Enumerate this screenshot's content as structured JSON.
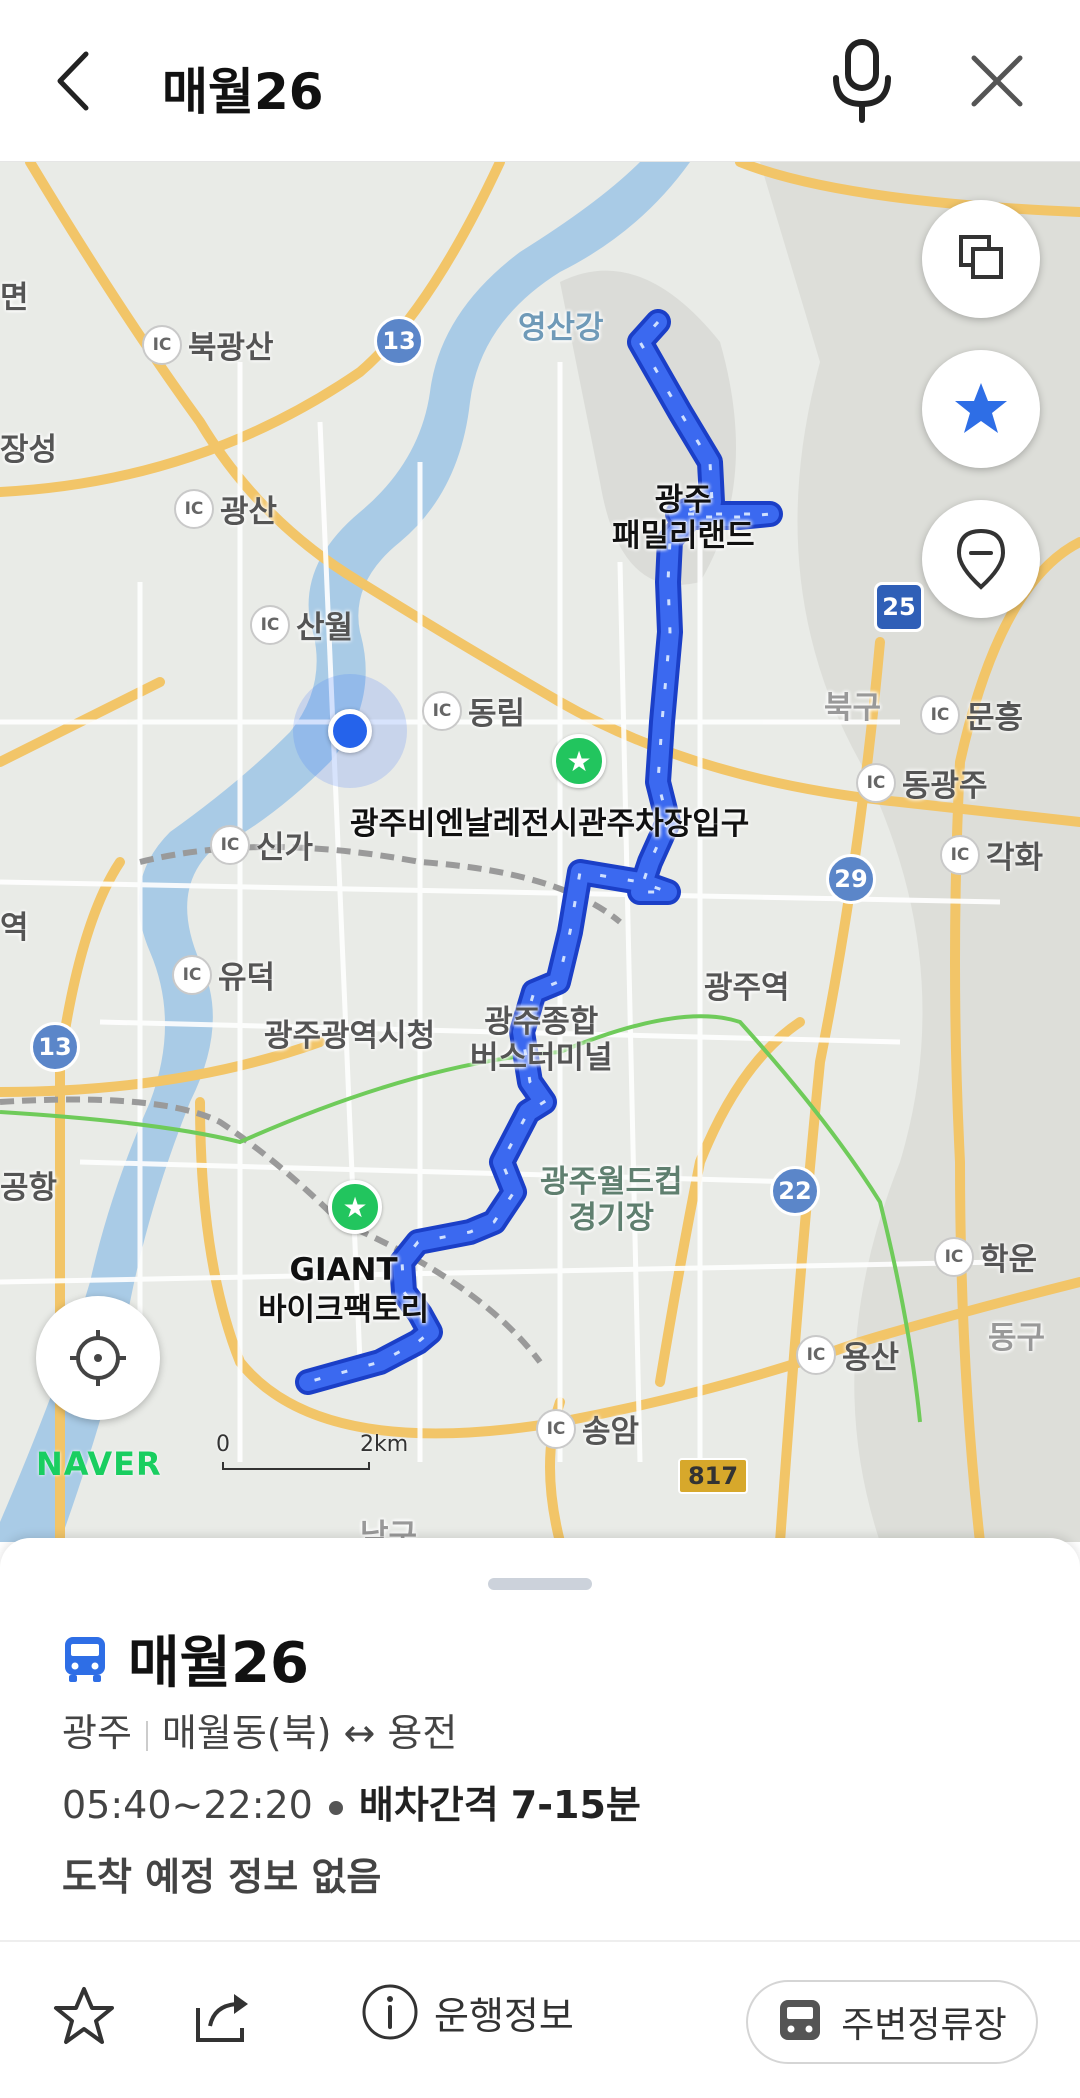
{
  "header": {
    "title": "매월26"
  },
  "map": {
    "labels": {
      "buk_gwangsan": "북광산",
      "gwangsan": "광산",
      "sanwol": "산월",
      "dongrim": "동림",
      "singa": "신가",
      "yudeok": "유덕",
      "munheung": "문흥",
      "donggwangju": "동광주",
      "gakhwa": "각화",
      "hakun": "학운",
      "yongsan": "용산",
      "songam": "송암",
      "yeongsangang": "영산강",
      "family_land": "광주\n패밀리랜드",
      "biennale": "광주비엔날레전시관주차장입구",
      "city_hall": "광주광역시청",
      "terminal": "광주종합\n버스터미널",
      "gwangju_station": "광주역",
      "world_cup": "광주월드컵\n경기장",
      "giant": "GIANT\n바이크팩토리",
      "bukgu": "북구",
      "donggu": "동구",
      "namgu": "남구",
      "jangseong": "장성",
      "myeon": "면",
      "gonghang": "공항",
      "yeok": "역"
    },
    "ic_badge": "IC",
    "road_numbers": {
      "r13a": "13",
      "r13b": "13",
      "r25": "25",
      "r29": "29",
      "r22": "22",
      "r817": "817"
    },
    "logo": "NAVER",
    "scale": {
      "start": "0",
      "end": "2km"
    }
  },
  "sheet": {
    "route_name": "매월26",
    "region": "광주",
    "direction": "매월동(북) ↔ 용전",
    "hours": "05:40~22:20",
    "interval_label": "배차간격",
    "interval_value": "7-15분",
    "arrival": "도착 예정 정보 없음"
  },
  "actions": {
    "info_label": "운행정보",
    "nearby_label": "주변정류장"
  },
  "colors": {
    "route": "#2f56e0",
    "accent_blue": "#2563eb",
    "poi_green": "#22c55e",
    "naver_green": "#19ce60"
  }
}
